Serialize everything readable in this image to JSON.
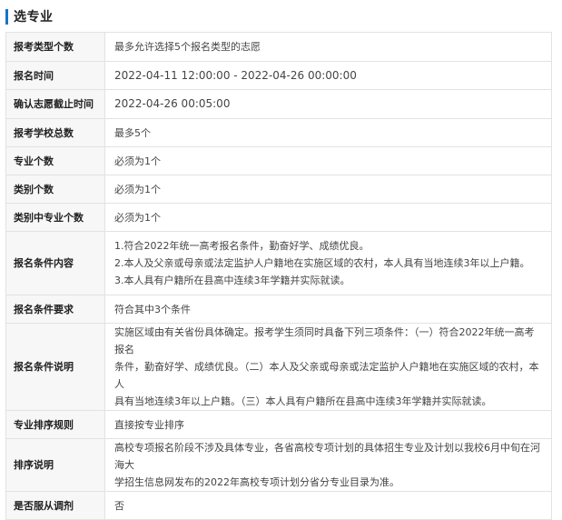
{
  "section": {
    "title": "选专业"
  },
  "rows": [
    {
      "label": "报考类型个数",
      "value": "最多允许选择5个报名类型的志愿"
    },
    {
      "label": "报名时间",
      "value": "2022-04-11 12:00:00 - 2022-04-26 00:00:00"
    },
    {
      "label": "确认志愿截止时间",
      "value": "2022-04-26 00:05:00"
    },
    {
      "label": "报考学校总数",
      "value": "最多5个"
    },
    {
      "label": "专业个数",
      "value": "必须为1个"
    },
    {
      "label": "类别个数",
      "value": "必须为1个"
    },
    {
      "label": "类别中专业个数",
      "value": "必须为1个"
    },
    {
      "label": "报名条件内容",
      "lines": [
        "1.符合2022年统一高考报名条件，勤奋好学、成绩优良。",
        "2.本人及父亲或母亲或法定监护人户籍地在实施区域的农村，本人具有当地连续3年以上户籍。",
        "3.本人具有户籍所在县高中连续3年学籍并实际就读。"
      ]
    },
    {
      "label": "报名条件要求",
      "value": "符合其中3个条件"
    },
    {
      "label": "报名条件说明",
      "lines": [
        "实施区域由有关省份具体确定。报考学生须同时具备下列三项条件：（一）符合2022年统一高考报名",
        "条件，勤奋好学、成绩优良。（二）本人及父亲或母亲或法定监护人户籍地在实施区域的农村，本人",
        "具有当地连续3年以上户籍。（三）本人具有户籍所在县高中连续3年学籍并实际就读。"
      ]
    },
    {
      "label": "专业排序规则",
      "value": "直接按专业排序"
    },
    {
      "label": "排序说明",
      "lines": [
        "高校专项报名阶段不涉及具体专业，各省高校专项计划的具体招生专业及计划以我校6月中旬在河海大",
        "学招生信息网发布的2022年高校专项计划分省分专业目录为准。"
      ]
    },
    {
      "label": "是否服从调剂",
      "value": "否"
    }
  ]
}
